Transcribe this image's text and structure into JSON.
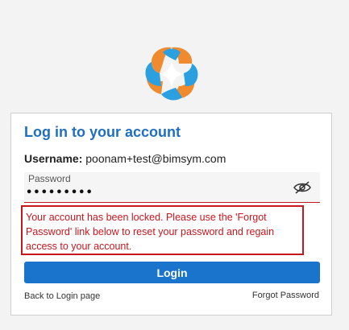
{
  "form": {
    "title": "Log in to your account",
    "username_label": "Username:",
    "username_value": "poonam+test@bimsym.com",
    "password_label": "Password",
    "password_value": "•••••••••",
    "error_message": "Your account has been locked. Please use the 'Forgot Password' link below to reset your password and regain access to your account.",
    "login_button": "Login",
    "back_link": "Back to Login page",
    "forgot_link": "Forgot Password"
  },
  "colors": {
    "accent": "#1a74cc",
    "title": "#1f6fc0",
    "error": "#c8161d",
    "logo_orange": "#ef8a2e",
    "logo_blue": "#2aa0e0"
  },
  "icons": {
    "logo": "brand-logo",
    "password_toggle": "eye-slash-icon"
  }
}
